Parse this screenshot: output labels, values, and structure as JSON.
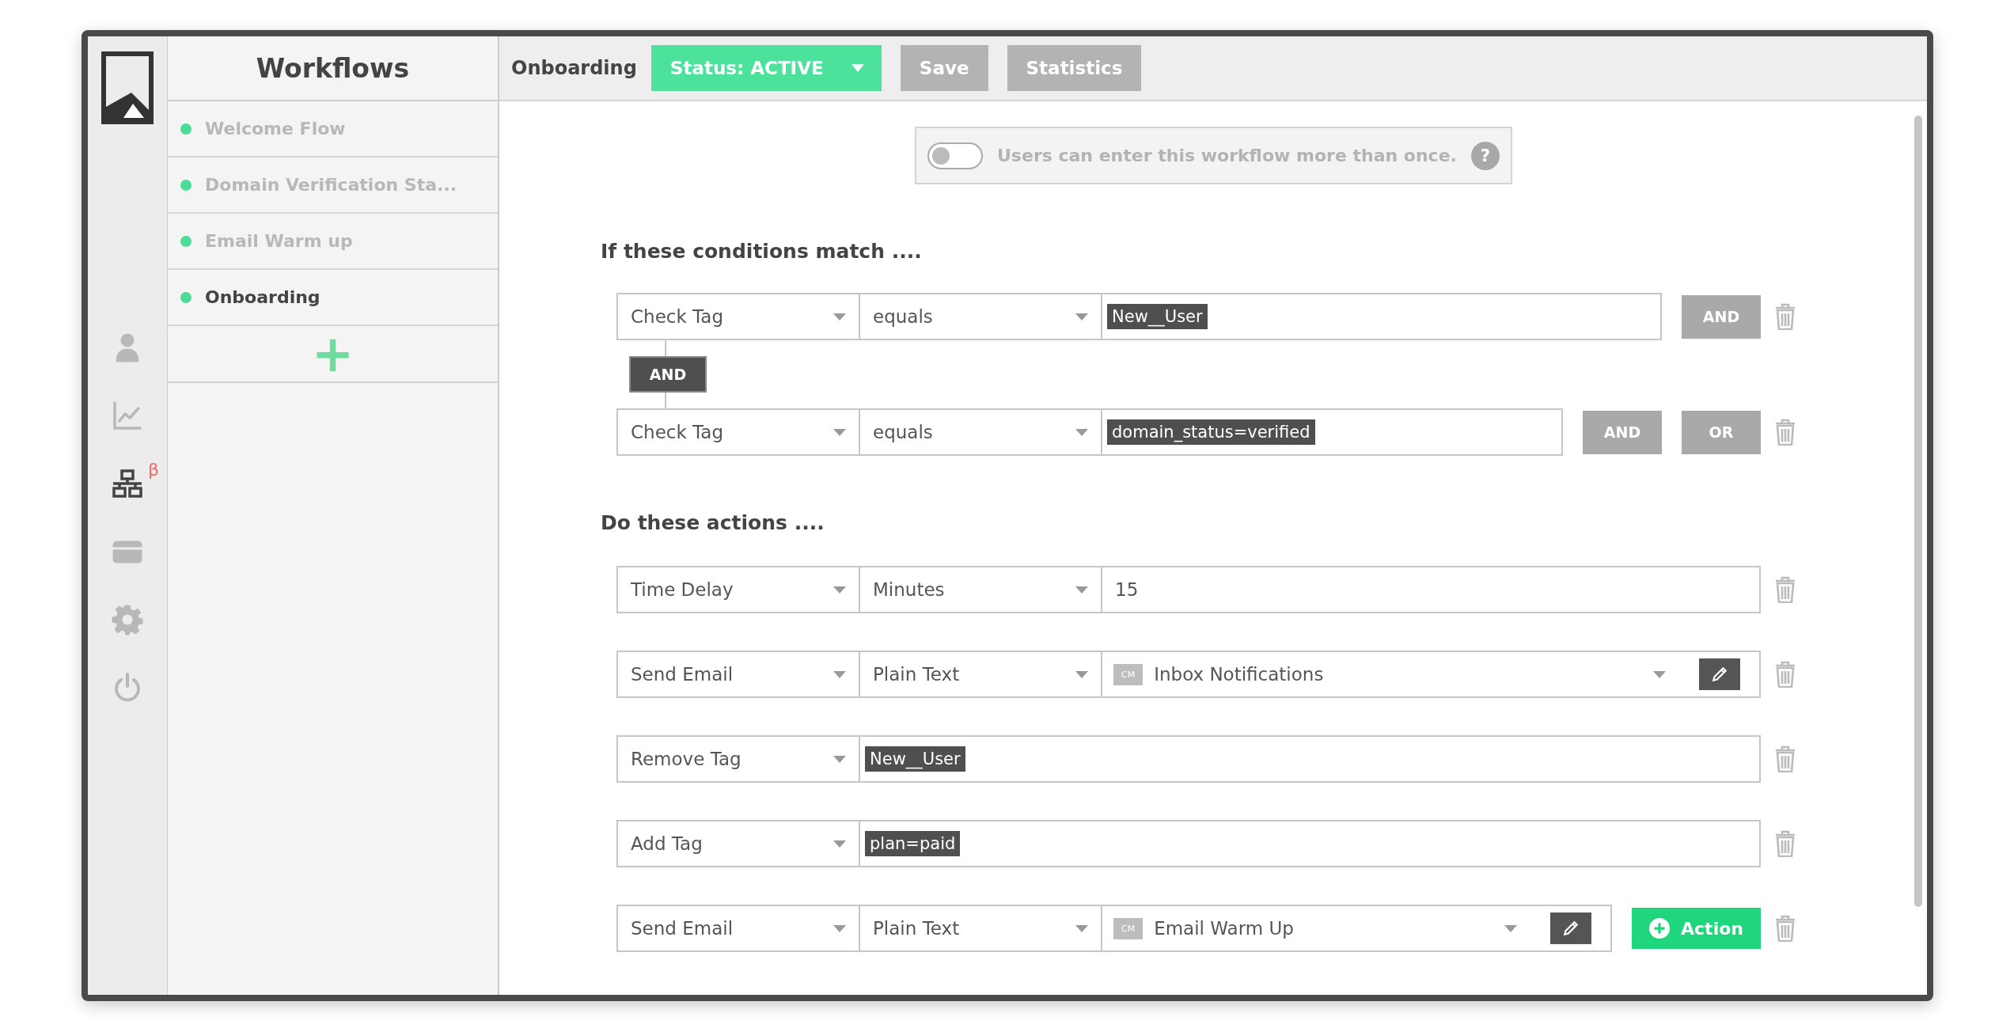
{
  "sidebar": {
    "nav": [
      {
        "kind": "user",
        "selected": false
      },
      {
        "kind": "chart",
        "selected": false
      },
      {
        "kind": "network",
        "selected": true,
        "badge": "β"
      },
      {
        "kind": "card",
        "selected": false
      },
      {
        "kind": "gear",
        "selected": false
      },
      {
        "kind": "power",
        "selected": false
      }
    ]
  },
  "workflows": {
    "title": "Workflows",
    "items": [
      {
        "name": "Welcome Flow",
        "selected": false
      },
      {
        "name": "Domain Verification Sta...",
        "selected": false
      },
      {
        "name": "Email Warm up",
        "selected": false
      },
      {
        "name": "Onboarding",
        "selected": true
      }
    ],
    "add": "+"
  },
  "toolbar": {
    "name": "Onboarding",
    "status": {
      "label": "Status: ACTIVE",
      "active": true
    },
    "buttons": [
      "Save",
      "Statistics"
    ]
  },
  "reentry": {
    "on": false,
    "label": "Users can enter this workflow more than once.",
    "help": "?"
  },
  "conditions": {
    "heading": "If these conditions match ....",
    "items": [
      {
        "field": "Check Tag",
        "operator": "equals",
        "tag": "New__User",
        "buttons": [
          "AND"
        ]
      },
      {
        "connector": "AND",
        "field": "Check Tag",
        "operator": "equals",
        "tag": "domain_status=verified",
        "buttons": [
          "AND",
          "OR"
        ]
      }
    ]
  },
  "actions": {
    "heading": "Do these actions ....",
    "items": [
      {
        "kind": "delay",
        "type": "Time Delay",
        "option": "Minutes",
        "value": "15"
      },
      {
        "kind": "email",
        "type": "Send Email",
        "option": "Plain Text",
        "chip": "CM",
        "template": "Inbox Notifications"
      },
      {
        "kind": "tag",
        "type": "Remove Tag",
        "tag": "New__User"
      },
      {
        "kind": "tag",
        "type": "Add Tag",
        "tag": "plan=paid"
      },
      {
        "kind": "email",
        "type": "Send Email",
        "option": "Plain Text",
        "chip": "CM",
        "template": "Email Warm Up",
        "add_button": "Action"
      }
    ]
  }
}
